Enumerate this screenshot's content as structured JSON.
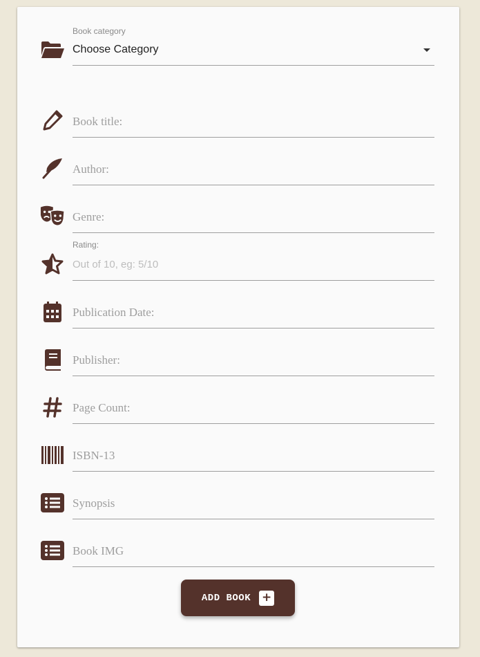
{
  "form": {
    "category": {
      "label": "Book category",
      "selected": "Choose Category",
      "icon": "folder-open-icon"
    },
    "fields": {
      "title": {
        "placeholder": "Book title:",
        "icon": "pencil-icon"
      },
      "author": {
        "placeholder": "Author:",
        "icon": "feather-icon"
      },
      "genre": {
        "placeholder": "Genre:",
        "icon": "theater-masks-icon"
      },
      "rating": {
        "label": "Rating:",
        "placeholder": "Out of 10, eg: 5/10",
        "icon": "star-half-icon"
      },
      "publication_date": {
        "placeholder": "Publication Date:",
        "icon": "calendar-icon"
      },
      "publisher": {
        "placeholder": "Publisher:",
        "icon": "book-icon"
      },
      "page_count": {
        "placeholder": "Page Count:",
        "icon": "hashtag-icon"
      },
      "isbn": {
        "placeholder": "ISBN-13",
        "icon": "barcode-icon"
      },
      "synopsis": {
        "placeholder": "Synopsis",
        "icon": "list-icon"
      },
      "image": {
        "placeholder": "Book IMG",
        "icon": "list-icon"
      }
    },
    "submit": {
      "label": "ADD BOOK",
      "icon": "plus-square-icon"
    }
  },
  "colors": {
    "icon": "#54322b",
    "button": "#54322b",
    "background": "#ede8d9",
    "card": "#fafafa"
  }
}
